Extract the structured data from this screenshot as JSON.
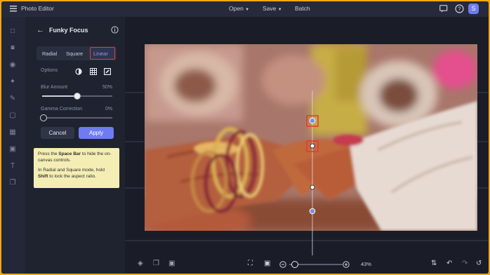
{
  "app": {
    "title": "Photo Editor"
  },
  "topbar": {
    "open_label": "Open",
    "save_label": "Save",
    "batch_label": "Batch",
    "avatar_initial": "S"
  },
  "panel": {
    "title": "Funky Focus",
    "tabs": [
      "Radial",
      "Square",
      "Linear"
    ],
    "active_tab": "Linear",
    "options_label": "Options",
    "blur_label": "Blur Amount",
    "blur_value": "50%",
    "blur_fraction": 0.5,
    "gamma_label": "Gamma Correction",
    "gamma_value": "0%",
    "gamma_fraction": 0,
    "cancel_label": "Cancel",
    "apply_label": "Apply",
    "tip_line1_pre": "Press the ",
    "tip_line1_bold": "Space Bar",
    "tip_line1_post": " to hide the on-canvas controls.",
    "tip_line2_pre": "In Radial and Square mode, hold ",
    "tip_line2_bold": "Shift",
    "tip_line2_post": " to lock the aspect ratio."
  },
  "bottombar": {
    "zoom_level": "43%"
  },
  "colors": {
    "accent": "#6f7cf0",
    "highlight_box": "#e53935",
    "tip_bg": "#f4eeb4",
    "frame_border": "#f4a714"
  }
}
